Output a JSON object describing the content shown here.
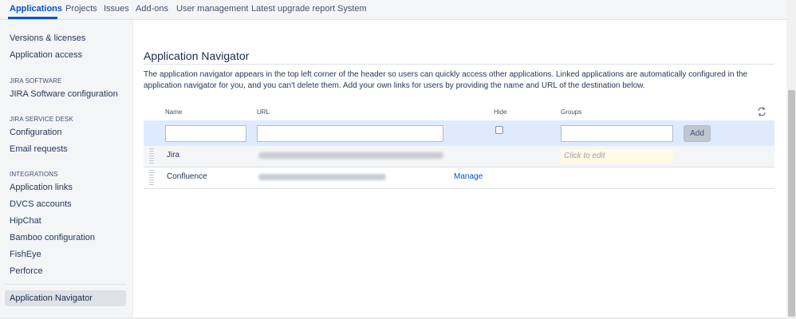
{
  "top_nav": {
    "tabs": [
      {
        "label": "Applications",
        "active": true
      },
      {
        "label": "Projects"
      },
      {
        "label": "Issues"
      },
      {
        "label": "Add-ons"
      },
      {
        "label": "User management"
      },
      {
        "label": "Latest upgrade report"
      },
      {
        "label": "System"
      }
    ]
  },
  "sidebar": {
    "items_top": [
      "Versions & licenses",
      "Application access"
    ],
    "section_jira_software": {
      "heading": "JIRA SOFTWARE",
      "items": [
        "JIRA Software configuration"
      ]
    },
    "section_service_desk": {
      "heading": "JIRA SERVICE DESK",
      "items": [
        "Configuration",
        "Email requests"
      ]
    },
    "section_integrations": {
      "heading": "INTEGRATIONS",
      "items": [
        "Application links",
        "DVCS accounts",
        "HipChat",
        "Bamboo configuration",
        "FishEye",
        "Perforce"
      ]
    },
    "active_item": "Application Navigator"
  },
  "main": {
    "title": "Application Navigator",
    "description": "The application navigator appears in the top left corner of the header so users can quickly access other applications. Linked applications are automatically configured in the application navigator for you, and you can't delete them. Add your own links for users by providing the name and URL of the destination below.",
    "table": {
      "headers": {
        "name": "Name",
        "url": "URL",
        "hide": "Hide",
        "groups": "Groups"
      },
      "add_button": "Add",
      "rows": [
        {
          "name": "Jira",
          "groups_placeholder": "Click to edit"
        },
        {
          "name": "Confluence",
          "action": "Manage"
        }
      ]
    }
  },
  "colors": {
    "accent": "#0052cc",
    "add_row_bg": "#deebff",
    "sidebar_bg": "#f4f5f7"
  }
}
